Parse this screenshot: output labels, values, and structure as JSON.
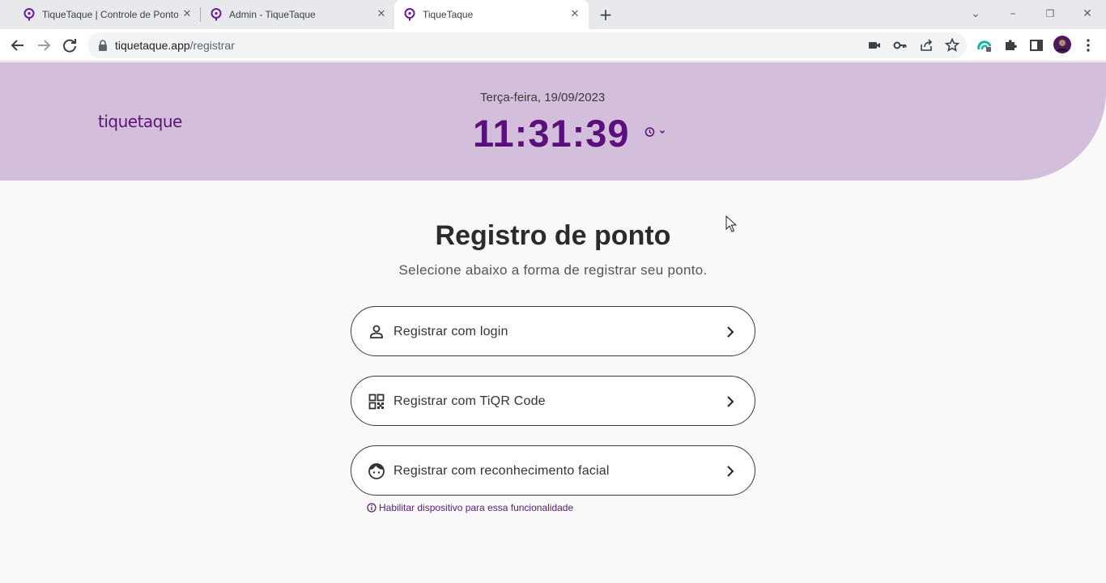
{
  "browser": {
    "tabs": [
      {
        "title": "TiqueTaque | Controle de Ponto C",
        "active": false
      },
      {
        "title": "Admin - TiqueTaque",
        "active": false
      },
      {
        "title": "TiqueTaque",
        "active": true
      }
    ],
    "url_domain": "tiquetaque.app",
    "url_path": "/registrar",
    "toolbar_icons": [
      "camera-icon",
      "key-icon",
      "share-icon",
      "star-icon",
      "extension-grammar-icon",
      "puzzle-icon",
      "sidepanel-icon",
      "profile-avatar",
      "kebab-menu-icon"
    ]
  },
  "header": {
    "logo": "tiquetaque",
    "date": "Terça-feira, 19/09/2023",
    "time": "11:31:39"
  },
  "main": {
    "title": "Registro de ponto",
    "subtitle": "Selecione abaixo a forma de registrar seu ponto.",
    "options": [
      {
        "label": "Registrar com login",
        "icon": "person-icon"
      },
      {
        "label": "Registrar com TiQR Code",
        "icon": "qr-code-icon"
      },
      {
        "label": "Registrar com reconhecimento facial",
        "icon": "face-icon"
      }
    ],
    "hint": "Habilitar dispositivo para essa funcionalidade"
  },
  "colors": {
    "brand": "#5a0f7b",
    "hero_bg": "#d3bedb",
    "page_bg": "#f9f9f9"
  }
}
